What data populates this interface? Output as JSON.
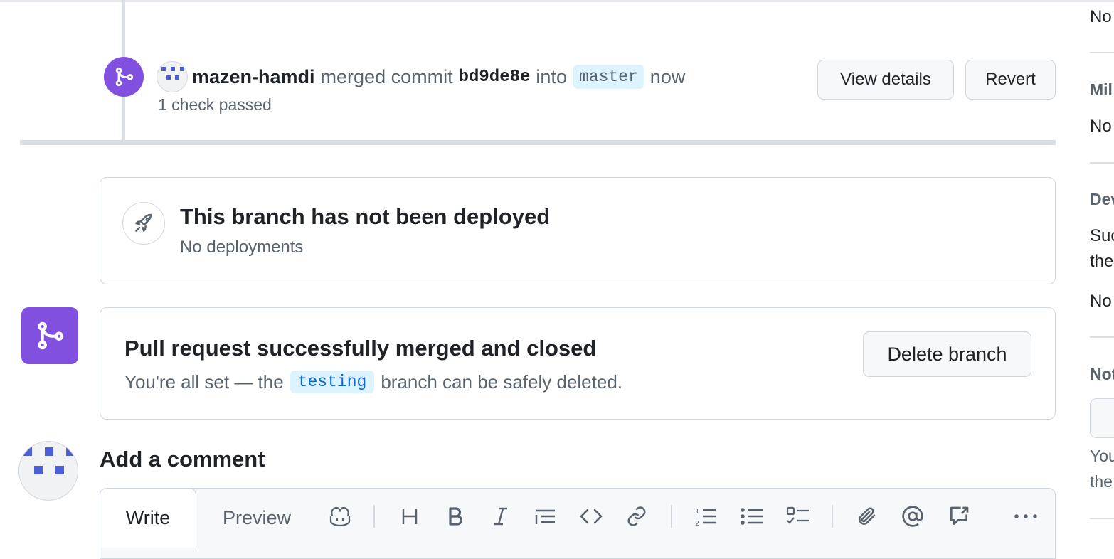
{
  "merge_event": {
    "username": "mazen-hamdi",
    "action": "merged commit",
    "commit_sha": "bd9de8e",
    "into_word": "into",
    "target_branch": "master",
    "time": "now",
    "checks": "1 check passed",
    "view_details_label": "View details",
    "revert_label": "Revert"
  },
  "deploy": {
    "title": "This branch has not been deployed",
    "subtitle": "No deployments"
  },
  "merged_status": {
    "title": "Pull request successfully merged and closed",
    "sub_prefix": "You're all set — the",
    "branch": "testing",
    "sub_suffix": "branch can be safely deleted.",
    "delete_label": "Delete branch"
  },
  "comment": {
    "heading": "Add a comment",
    "tab_write": "Write",
    "tab_preview": "Preview",
    "toolbar_icons": [
      "copilot-icon",
      "heading-icon",
      "bold-icon",
      "italic-icon",
      "quote-icon",
      "code-icon",
      "link-icon",
      "numbered-list-icon",
      "bullet-list-icon",
      "task-list-icon",
      "attach-icon",
      "mention-icon",
      "reference-icon",
      "more-icon"
    ]
  },
  "sidebar": {
    "t1": "No",
    "milestone_head": "Mil",
    "t2": "No",
    "dev_head": "Dev",
    "t3": "Suc",
    "t4": "the",
    "t5": "No",
    "notif_head": "Not",
    "t6": "You",
    "t7": "the"
  },
  "colors": {
    "merged_purple": "#8250df",
    "accent_blue": "#0969da",
    "branch_chip_bg": "#ddf4ff",
    "identicon_blue": "#4c5fd5"
  }
}
